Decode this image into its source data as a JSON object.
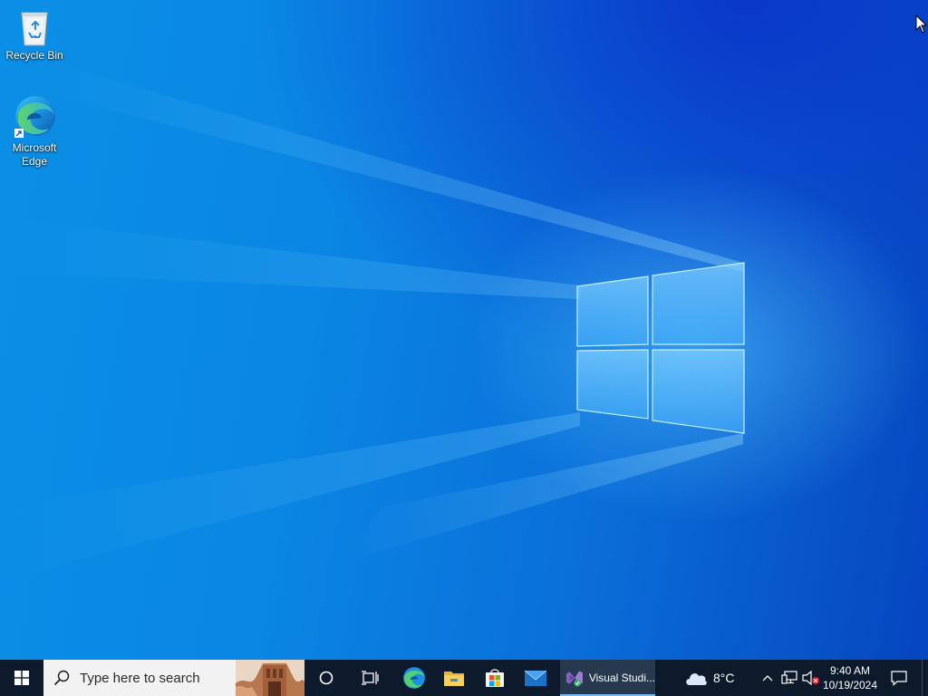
{
  "desktop": {
    "icons": [
      {
        "label": "Recycle Bin",
        "icon": "recycle-bin-icon"
      },
      {
        "label": "Microsoft\nEdge",
        "icon": "edge-icon"
      }
    ]
  },
  "taskbar": {
    "start_icon": "windows-logo-icon",
    "search": {
      "placeholder": "Type here to search",
      "icon": "search-icon"
    },
    "cortana_icon": "cortana-circle-icon",
    "taskview_icon": "task-view-icon",
    "pinned": [
      {
        "name": "Microsoft Edge",
        "icon": "edge-icon"
      },
      {
        "name": "File Explorer",
        "icon": "folder-icon"
      },
      {
        "name": "Microsoft Store",
        "icon": "store-icon"
      },
      {
        "name": "Mail",
        "icon": "mail-icon"
      }
    ],
    "running_app": {
      "label": "Visual Studi...",
      "icon": "visual-studio-icon"
    },
    "weather": {
      "temp": "8°C",
      "icon": "cloud-icon"
    },
    "tray": {
      "chevron_icon": "chevron-up-icon",
      "network_icon": "network-icon",
      "volume_icon": "volume-muted-icon"
    },
    "clock": {
      "time": "9:40 AM",
      "date": "10/19/2024"
    },
    "notification_icon": "notification-icon"
  },
  "colors": {
    "taskbar_bg": "#0c1a2c",
    "accent": "#76b9ed",
    "desktop_blue": "#0a86e4"
  }
}
